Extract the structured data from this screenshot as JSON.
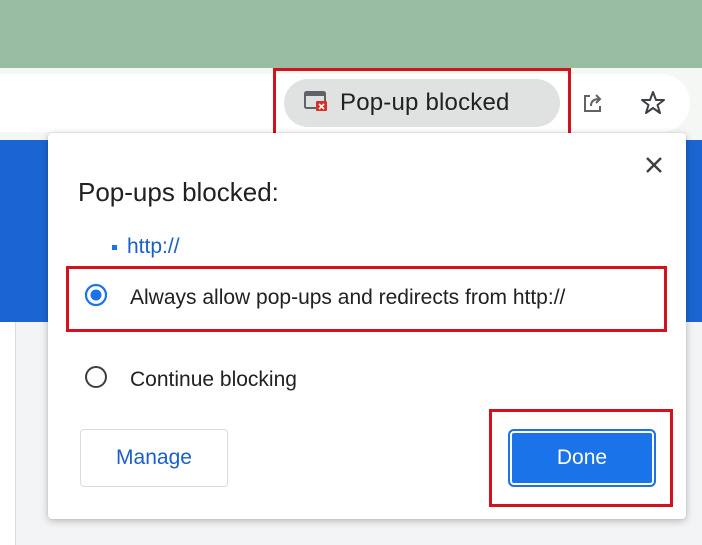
{
  "toolbar": {
    "popup_chip_label": "Pop-up blocked"
  },
  "popup": {
    "title": "Pop-ups blocked:",
    "blocked_url": "http://",
    "options": [
      {
        "label": "Always allow pop-ups and redirects from http://",
        "selected": true
      },
      {
        "label": "Continue blocking",
        "selected": false
      }
    ],
    "manage_label": "Manage",
    "done_label": "Done"
  },
  "colors": {
    "accent": "#1a73e8",
    "highlight": "#d3121e",
    "titlebar": "#99bda2"
  }
}
